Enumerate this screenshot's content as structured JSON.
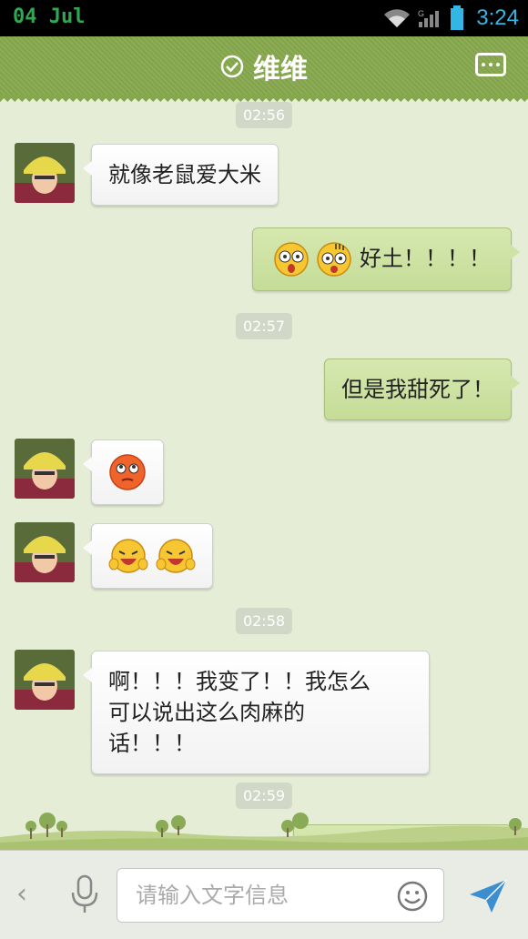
{
  "status_bar": {
    "date": "04 Jul",
    "time": "3:24"
  },
  "header": {
    "title": "维维",
    "menu_icon": "more-icon"
  },
  "messages": [
    {
      "type": "time",
      "text": "02:56"
    },
    {
      "type": "text",
      "side": "left",
      "text": "就像老鼠爱大米"
    },
    {
      "type": "text",
      "side": "right",
      "text": "好土！！！！",
      "emoji": [
        "shocked-face-icon",
        "shocked-face-icon"
      ]
    },
    {
      "type": "time",
      "text": "02:57"
    },
    {
      "type": "text",
      "side": "right",
      "text": "但是我甜死了！"
    },
    {
      "type": "emoji",
      "side": "left",
      "emoji": [
        "rolling-eyes-face-icon"
      ]
    },
    {
      "type": "emoji",
      "side": "left",
      "emoji": [
        "laughing-face-icon",
        "laughing-face-icon"
      ]
    },
    {
      "type": "time",
      "text": "02:58"
    },
    {
      "type": "text",
      "side": "left",
      "lines": [
        "啊！！！我变了！！我怎么",
        "可以说出这么肉麻的",
        "话！！！"
      ]
    },
    {
      "type": "time",
      "text": "02:59"
    }
  ],
  "input_bar": {
    "placeholder": "请输入文字信息"
  },
  "colors": {
    "header": "#86a84d",
    "right_bubble": "#cfe3a5",
    "left_bubble": "#ffffff",
    "send": "#3b8fd1"
  }
}
